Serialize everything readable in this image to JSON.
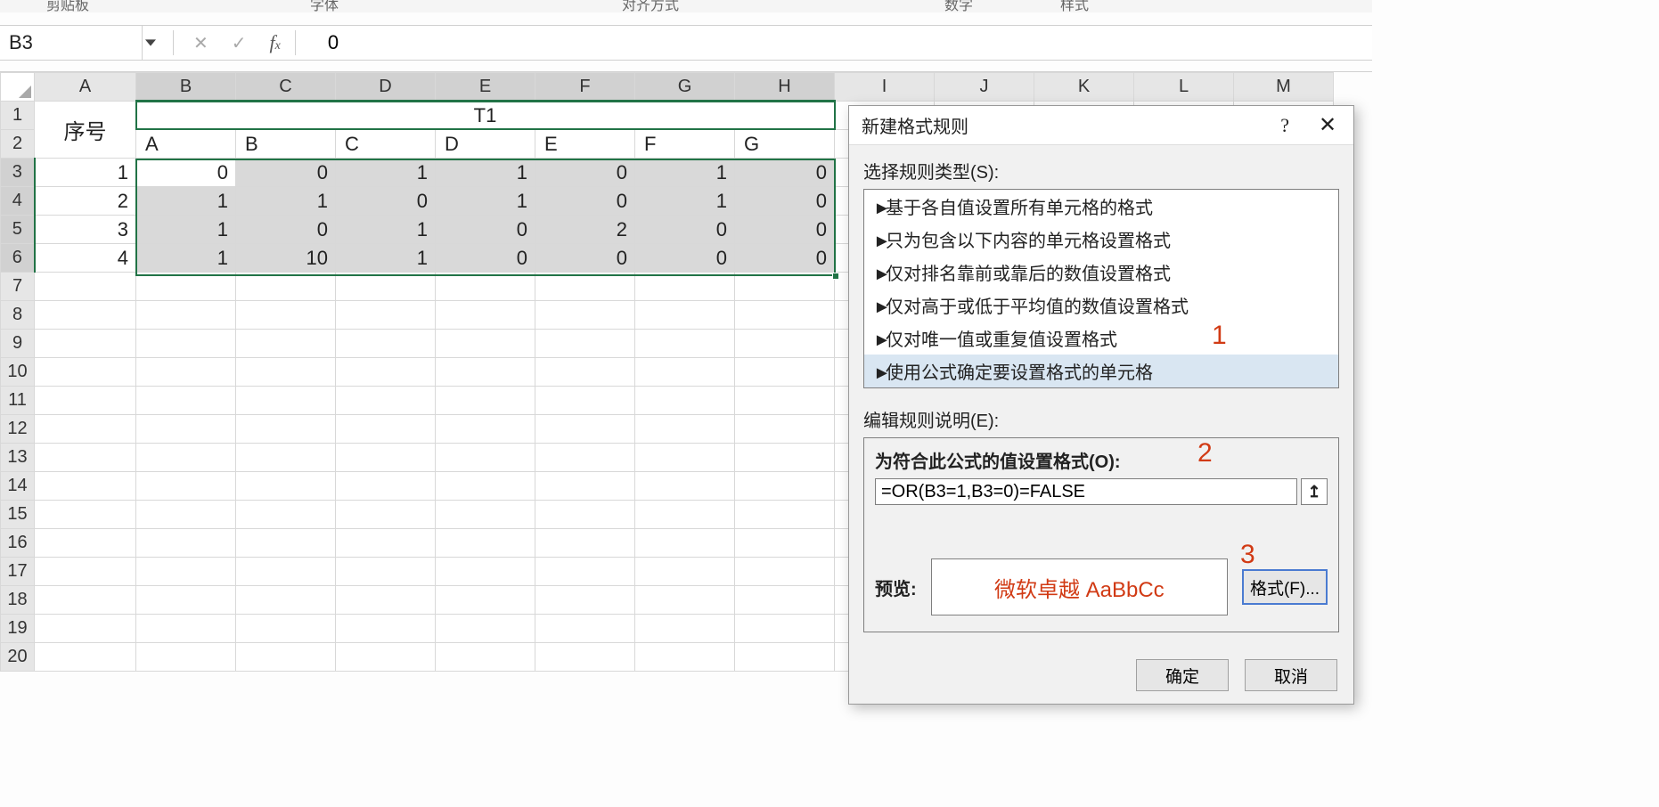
{
  "ribbon": {
    "r1": "剪贴板",
    "r2": "字体",
    "r3": "对齐方式",
    "r4": "数字",
    "r5": "样式"
  },
  "formula_bar": {
    "name_box": "B3",
    "value": "0"
  },
  "grid": {
    "col_headers": [
      "A",
      "B",
      "C",
      "D",
      "E",
      "F",
      "G",
      "H",
      "I",
      "J",
      "K",
      "L",
      "M"
    ],
    "row_headers": [
      "1",
      "2",
      "3",
      "4",
      "5",
      "6",
      "7",
      "8",
      "9",
      "10",
      "11",
      "12",
      "13",
      "14",
      "15",
      "16",
      "17",
      "18",
      "19",
      "20"
    ],
    "big_label": "序号",
    "title": "T1",
    "inner_headers": [
      "A",
      "B",
      "C",
      "D",
      "E",
      "F",
      "G"
    ],
    "seq": [
      "1",
      "2",
      "3",
      "4"
    ],
    "data": [
      [
        "0",
        "0",
        "1",
        "1",
        "0",
        "1",
        "0"
      ],
      [
        "1",
        "1",
        "0",
        "1",
        "0",
        "1",
        "0"
      ],
      [
        "1",
        "0",
        "1",
        "0",
        "2",
        "0",
        "0"
      ],
      [
        "1",
        "10",
        "1",
        "0",
        "0",
        "0",
        "0"
      ]
    ]
  },
  "dialog": {
    "title": "新建格式规则",
    "select_label": "选择规则类型(S):",
    "rules": [
      "基于各自值设置所有单元格的格式",
      "只为包含以下内容的单元格设置格式",
      "仅对排名靠前或靠后的数值设置格式",
      "仅对高于或低于平均值的数值设置格式",
      "仅对唯一值或重复值设置格式",
      "使用公式确定要设置格式的单元格"
    ],
    "edit_label": "编辑规则说明(E):",
    "formula_label": "为符合此公式的值设置格式(O):",
    "formula_value": "=OR(B3=1,B3=0)=FALSE",
    "preview_label": "预览:",
    "preview_text": "微软卓越 AaBbCc",
    "format_btn": "格式(F)...",
    "ok": "确定",
    "cancel": "取消"
  },
  "callouts": {
    "c1": "1",
    "c2": "2",
    "c3": "3"
  }
}
